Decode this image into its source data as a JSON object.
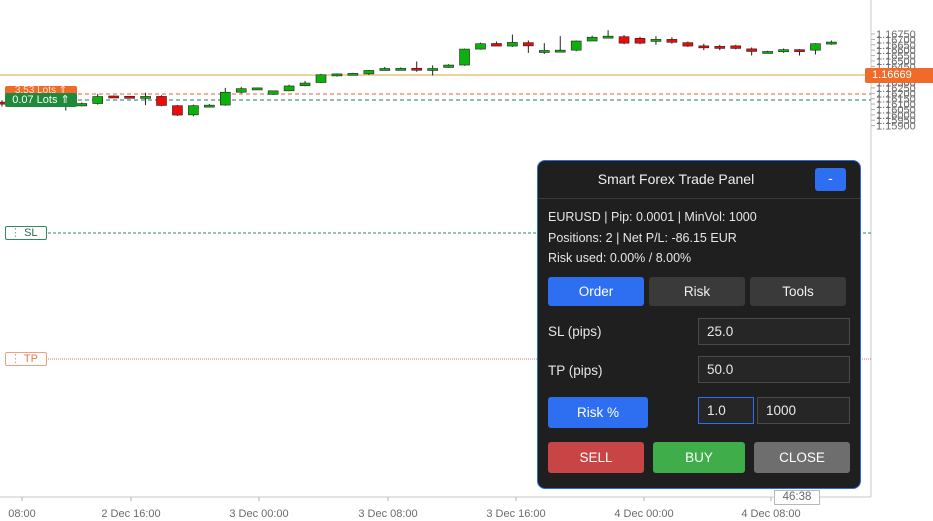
{
  "price_axis": {
    "labels": [
      "1.16750",
      "1.16700",
      "1.16650",
      "1.16600",
      "1.16550",
      "1.16500",
      "1.16450",
      "1.16400",
      "1.16350",
      "1.16300",
      "1.16250",
      "1.16200",
      "1.16150",
      "1.16100",
      "1.16050",
      "1.16000",
      "1.15950",
      "1.15900"
    ],
    "current_price": "1.16669"
  },
  "time_axis": {
    "labels": [
      "08:00",
      "2 Dec 16:00",
      "3 Dec 00:00",
      "3 Dec 08:00",
      "3 Dec 16:00",
      "4 Dec 00:00",
      "4 Dec 08:00"
    ]
  },
  "countdown": "46:38",
  "chart_tags": {
    "sell_lots": "3.53 Lots",
    "buy_lots": "0.07 Lots",
    "sl_label": "SL",
    "tp_label": "TP"
  },
  "colors": {
    "bull": "#0cb20c",
    "bear": "#ee0a0a",
    "price_line": "#d9a43a",
    "price_tag": "#f06a2a",
    "panel_accent": "#2e6ff2",
    "sell": "#c84545",
    "buy": "#3fae4a",
    "close": "#6e6e6e"
  },
  "candles": [
    {
      "o": 1.16118,
      "h": 1.16136,
      "l": 1.16077,
      "c": 1.16105
    },
    {
      "o": 1.161,
      "h": 1.1614,
      "l": 1.16092,
      "c": 1.16118
    },
    {
      "o": 1.16118,
      "h": 1.16135,
      "l": 1.161,
      "c": 1.16108
    },
    {
      "o": 1.16106,
      "h": 1.1612,
      "l": 1.1608,
      "c": 1.16102
    },
    {
      "o": 1.16103,
      "h": 1.16115,
      "l": 1.1604,
      "c": 1.16083
    },
    {
      "o": 1.16083,
      "h": 1.16115,
      "l": 1.16078,
      "c": 1.16105
    },
    {
      "o": 1.16105,
      "h": 1.16195,
      "l": 1.16095,
      "c": 1.1617
    },
    {
      "o": 1.16175,
      "h": 1.1618,
      "l": 1.16165,
      "c": 1.16172
    },
    {
      "o": 1.16172,
      "h": 1.16175,
      "l": 1.1616,
      "c": 1.1617
    },
    {
      "o": 1.1617,
      "h": 1.16205,
      "l": 1.1609,
      "c": 1.16171
    },
    {
      "o": 1.16171,
      "h": 1.16182,
      "l": 1.1608,
      "c": 1.16087
    },
    {
      "o": 1.16085,
      "h": 1.16092,
      "l": 1.1599,
      "c": 1.15998
    },
    {
      "o": 1.16,
      "h": 1.16095,
      "l": 1.15987,
      "c": 1.16085
    },
    {
      "o": 1.16083,
      "h": 1.161,
      "l": 1.1607,
      "c": 1.1609
    },
    {
      "o": 1.16091,
      "h": 1.1625,
      "l": 1.16085,
      "c": 1.1621
    },
    {
      "o": 1.1621,
      "h": 1.1626,
      "l": 1.162,
      "c": 1.16243
    },
    {
      "o": 1.16248,
      "h": 1.16253,
      "l": 1.1624,
      "c": 1.1625
    },
    {
      "o": 1.1619,
      "h": 1.16226,
      "l": 1.16185,
      "c": 1.16223
    },
    {
      "o": 1.16223,
      "h": 1.1628,
      "l": 1.1622,
      "c": 1.16268
    },
    {
      "o": 1.1627,
      "h": 1.16315,
      "l": 1.16265,
      "c": 1.16295
    },
    {
      "o": 1.163,
      "h": 1.1638,
      "l": 1.16295,
      "c": 1.16372
    },
    {
      "o": 1.16375,
      "h": 1.16385,
      "l": 1.16355,
      "c": 1.1638
    },
    {
      "o": 1.1638,
      "h": 1.1639,
      "l": 1.16375,
      "c": 1.16385
    },
    {
      "o": 1.1638,
      "h": 1.16415,
      "l": 1.1637,
      "c": 1.16412
    },
    {
      "o": 1.1642,
      "h": 1.16445,
      "l": 1.16415,
      "c": 1.1643
    },
    {
      "o": 1.1643,
      "h": 1.1644,
      "l": 1.1642,
      "c": 1.16431
    },
    {
      "o": 1.16432,
      "h": 1.16495,
      "l": 1.164,
      "c": 1.16419
    },
    {
      "o": 1.16418,
      "h": 1.1646,
      "l": 1.16365,
      "c": 1.1643
    },
    {
      "o": 1.1644,
      "h": 1.1647,
      "l": 1.16435,
      "c": 1.16462
    },
    {
      "o": 1.16462,
      "h": 1.16615,
      "l": 1.16455,
      "c": 1.1661
    },
    {
      "o": 1.1661,
      "h": 1.1667,
      "l": 1.16605,
      "c": 1.1666
    },
    {
      "o": 1.16662,
      "h": 1.1668,
      "l": 1.1664,
      "c": 1.16638
    },
    {
      "o": 1.16638,
      "h": 1.16745,
      "l": 1.1663,
      "c": 1.16672
    },
    {
      "o": 1.1667,
      "h": 1.1669,
      "l": 1.16575,
      "c": 1.1664
    },
    {
      "o": 1.1658,
      "h": 1.16665,
      "l": 1.16565,
      "c": 1.16597
    },
    {
      "o": 1.16598,
      "h": 1.1673,
      "l": 1.1659,
      "c": 1.166
    },
    {
      "o": 1.166,
      "h": 1.1669,
      "l": 1.1659,
      "c": 1.16685
    },
    {
      "o": 1.16685,
      "h": 1.16735,
      "l": 1.16685,
      "c": 1.1672
    },
    {
      "o": 1.16725,
      "h": 1.16785,
      "l": 1.16725,
      "c": 1.1673
    },
    {
      "o": 1.16725,
      "h": 1.1674,
      "l": 1.16655,
      "c": 1.16665
    },
    {
      "o": 1.1671,
      "h": 1.16725,
      "l": 1.16655,
      "c": 1.16665
    },
    {
      "o": 1.16685,
      "h": 1.1673,
      "l": 1.1665,
      "c": 1.167
    },
    {
      "o": 1.167,
      "h": 1.1672,
      "l": 1.1666,
      "c": 1.16673
    },
    {
      "o": 1.1667,
      "h": 1.1668,
      "l": 1.1663,
      "c": 1.16638
    },
    {
      "o": 1.1664,
      "h": 1.1666,
      "l": 1.166,
      "c": 1.16635
    },
    {
      "o": 1.16635,
      "h": 1.1665,
      "l": 1.166,
      "c": 1.16632
    },
    {
      "o": 1.1664,
      "h": 1.1665,
      "l": 1.16608,
      "c": 1.16616
    },
    {
      "o": 1.16612,
      "h": 1.16625,
      "l": 1.1655,
      "c": 1.16588
    },
    {
      "o": 1.1658,
      "h": 1.16595,
      "l": 1.1657,
      "c": 1.16588
    },
    {
      "o": 1.16585,
      "h": 1.16615,
      "l": 1.16575,
      "c": 1.16605
    },
    {
      "o": 1.16605,
      "h": 1.1661,
      "l": 1.1655,
      "c": 1.16598
    },
    {
      "o": 1.166,
      "h": 1.16665,
      "l": 1.1656,
      "c": 1.1666
    },
    {
      "o": 1.16665,
      "h": 1.1669,
      "l": 1.1665,
      "c": 1.16675
    }
  ],
  "panel": {
    "title": "Smart Forex Trade Panel",
    "minimize_label": "-",
    "info_line1": "EURUSD  |  Pip: 0.0001  |  MinVol: 1000",
    "info_line2": "Positions: 2  |  Net P/L: -86.15 EUR",
    "info_line3": "Risk used: 0.00% / 8.00%",
    "tabs": {
      "order": "Order",
      "risk": "Risk",
      "tools": "Tools"
    },
    "sl_label": "SL (pips)",
    "sl_value": "25.0",
    "tp_label": "TP (pips)",
    "tp_value": "50.0",
    "risk_button": "Risk %",
    "risk_value": "1.0",
    "volume_value": "1000",
    "sell_label": "SELL",
    "buy_label": "BUY",
    "close_label": "CLOSE"
  }
}
